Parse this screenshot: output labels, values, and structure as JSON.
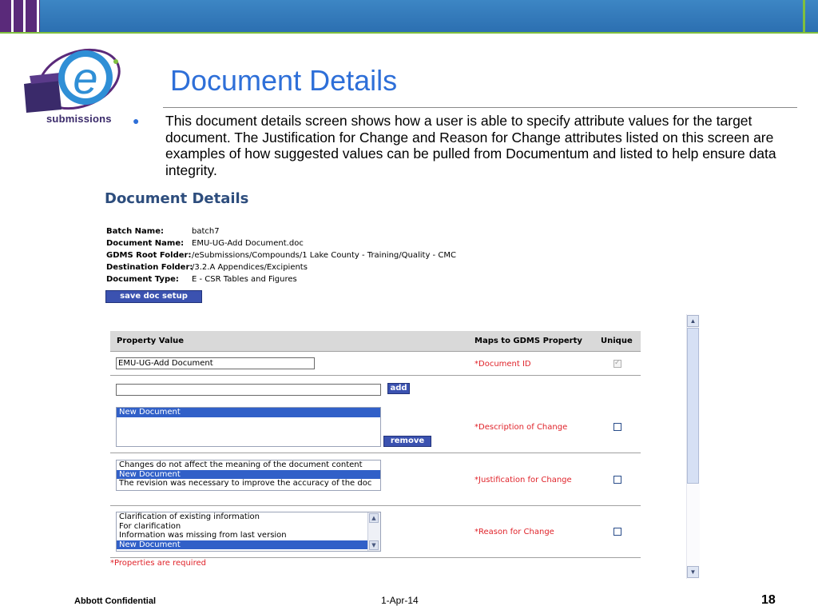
{
  "slide": {
    "title": "Document Details",
    "bullet": "This document details screen shows how a user is able to specify attribute values for the target document.  The Justification for Change and Reason for Change attributes listed on this screen are examples of how suggested values can be pulled from Documentum and listed to help ensure data integrity.",
    "logo_text": "submissions",
    "logo_letter": "e"
  },
  "colors": {
    "banner_blue": "#3d86c4",
    "banner_purple": "#5a2a7a",
    "accent_green": "#7fbf3f",
    "title_blue": "#2e6fd8",
    "button_blue": "#3b52b0",
    "selection_blue": "#3160c8",
    "required_red": "#e0232a"
  },
  "screen": {
    "title": "Document Details",
    "meta": [
      {
        "label": "Batch Name:",
        "value": "batch7"
      },
      {
        "label": "Document Name:",
        "value": "EMU-UG-Add Document.doc"
      },
      {
        "label": "GDMS Root Folder:",
        "value": "/eSubmissions/Compounds/1 Lake County - Training/Quality - CMC"
      },
      {
        "label": "Destination Folder:",
        "value": "/3.2.A Appendices/Excipients"
      },
      {
        "label": "Document Type:",
        "value": "E - CSR Tables and Figures"
      }
    ],
    "save_button": "save doc setup",
    "table": {
      "headers": {
        "property_value": "Property Value",
        "maps_to": "Maps to GDMS Property",
        "unique": "Unique"
      },
      "rows": {
        "document_id": {
          "input_value": "EMU-UG-Add Document",
          "property": "*Document ID",
          "unique_checked": true,
          "unique_disabled": true
        },
        "description": {
          "input_value": "",
          "add_button": "add",
          "list": [
            "New Document"
          ],
          "remove_button": "remove",
          "property": "*Description of Change",
          "unique_checked": false
        },
        "justification": {
          "list": [
            "Changes do not affect the meaning of the document content",
            "New Document",
            "The revision was necessary to improve the accuracy of the doc"
          ],
          "selected": "New Document",
          "property": "*Justification for Change",
          "unique_checked": false
        },
        "reason": {
          "list": [
            "Clarification of existing information",
            "For clarification",
            "Information was missing from last version",
            "New Document"
          ],
          "selected": "New Document",
          "property": "*Reason for Change",
          "unique_checked": false
        }
      },
      "required_note": "*Properties are required"
    },
    "scroll_up_icon": "triangle-up-icon",
    "scroll_down_icon": "triangle-down-icon"
  },
  "footer": {
    "confidential": "Abbott Confidential",
    "date": "1-Apr-14",
    "page": "18"
  }
}
